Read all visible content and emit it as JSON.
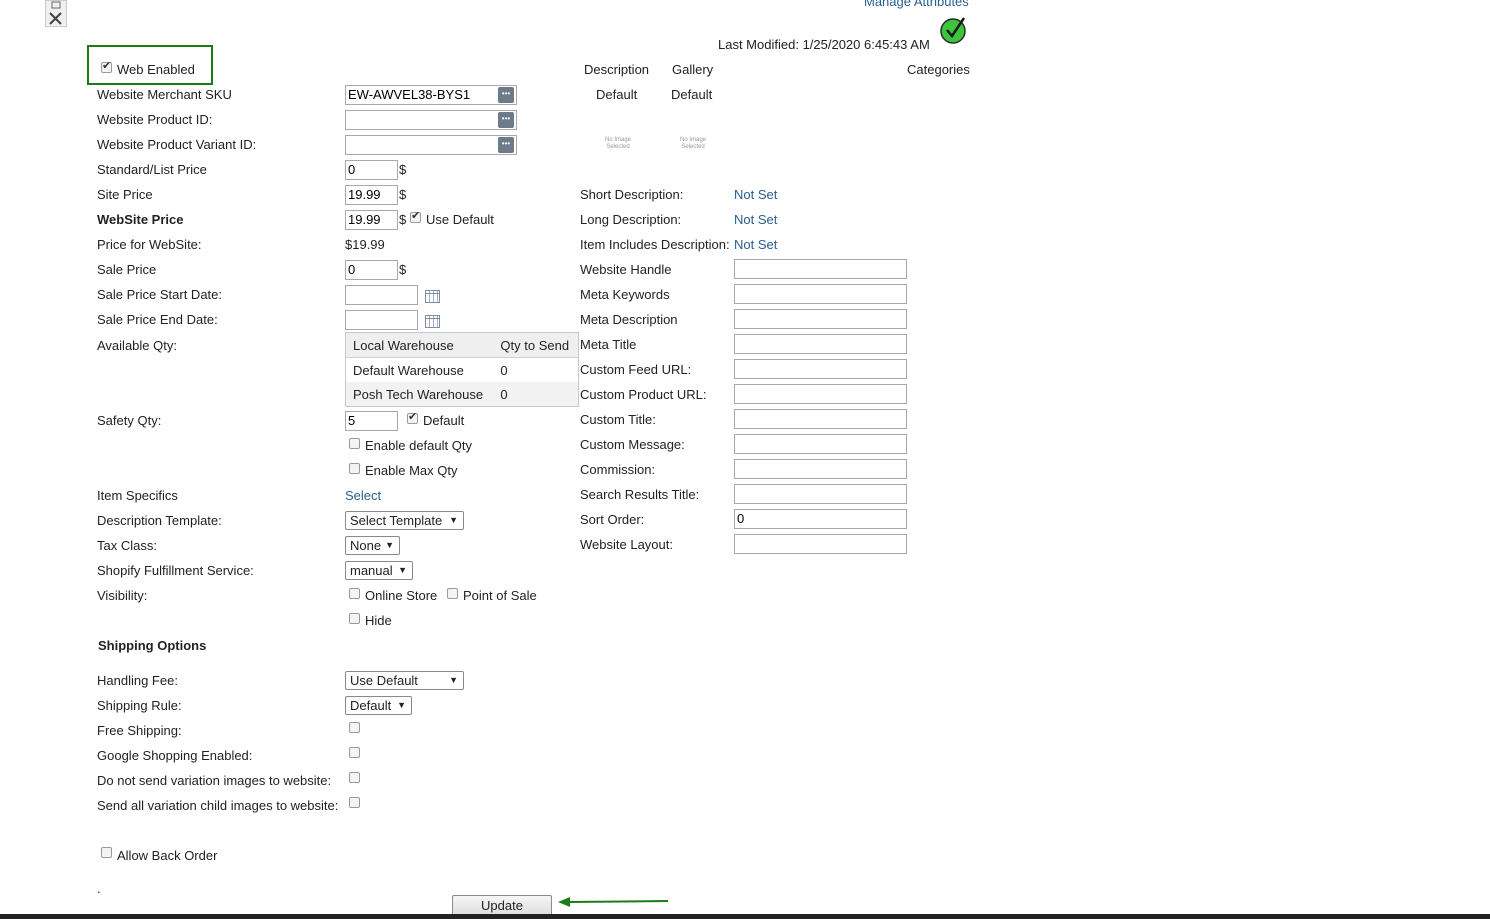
{
  "header": {
    "manage_attributes": "Manage Attributes",
    "last_modified_label": "Last Modified:",
    "last_modified_value": "1/25/2020 6:45:43 AM"
  },
  "web_enabled": {
    "label": "Web Enabled",
    "checked": true
  },
  "media_headers": {
    "description": "Description",
    "gallery": "Gallery",
    "categories": "Categories"
  },
  "media_defaults": {
    "description": "Default",
    "gallery": "Default"
  },
  "no_image": {
    "line1": "No Image",
    "line2": "Selected"
  },
  "left": {
    "merchant_sku": {
      "label": "Website Merchant SKU",
      "value": "EW-AWVEL38-BYS1"
    },
    "product_id": {
      "label": "Website Product ID:",
      "value": ""
    },
    "variant_id": {
      "label": "Website Product Variant ID:",
      "value": ""
    },
    "standard_price": {
      "label": "Standard/List Price",
      "value": "0",
      "unit": "$"
    },
    "site_price": {
      "label": "Site Price",
      "value": "19.99",
      "unit": "$"
    },
    "website_price": {
      "label": "WebSite Price",
      "value": "19.99",
      "unit": "$",
      "use_default_label": "Use Default",
      "use_default_checked": true
    },
    "price_for_website": {
      "label": "Price for WebSite:",
      "value": "$19.99"
    },
    "sale_price": {
      "label": "Sale Price",
      "value": "0",
      "unit": "$"
    },
    "sale_start": {
      "label": "Sale Price Start Date:",
      "value": ""
    },
    "sale_end": {
      "label": "Sale Price End Date:",
      "value": ""
    },
    "available_qty": {
      "label": "Available Qty:"
    },
    "warehouse": {
      "col_warehouse": "Local Warehouse",
      "col_qty": "Qty to Send",
      "rows": [
        {
          "name": "Default Warehouse",
          "qty": "0"
        },
        {
          "name": "Posh Tech Warehouse",
          "qty": "0"
        }
      ]
    },
    "safety_qty": {
      "label": "Safety Qty:",
      "value": "5",
      "default_label": "Default",
      "default_checked": true
    },
    "enable_default_qty": "Enable default Qty",
    "enable_max_qty": "Enable Max Qty",
    "item_specifics": {
      "label": "Item Specifics",
      "link": "Select"
    },
    "description_template": {
      "label": "Description Template:",
      "value": "Select Template"
    },
    "tax_class": {
      "label": "Tax Class:",
      "value": "None"
    },
    "fulfillment": {
      "label": "Shopify Fulfillment Service:",
      "value": "manual"
    },
    "visibility": {
      "label": "Visibility:",
      "online_store": "Online Store",
      "point_of_sale": "Point of Sale",
      "hide": "Hide"
    }
  },
  "shipping": {
    "heading": "Shipping Options",
    "handling_fee": {
      "label": "Handling Fee:",
      "value": "Use Default"
    },
    "shipping_rule": {
      "label": "Shipping Rule:",
      "value": "Default"
    },
    "free_shipping": "Free Shipping:",
    "google_shopping": "Google Shopping Enabled:",
    "no_variation_images": "Do not send variation images to website:",
    "all_variation_images": "Send all variation child images to website:",
    "allow_back_order": "Allow Back Order"
  },
  "right": {
    "short_description": {
      "label": "Short Description:",
      "value": "Not Set"
    },
    "long_description": {
      "label": "Long Description:",
      "value": "Not Set"
    },
    "item_includes": {
      "label": "Item Includes Description:",
      "value": "Not Set"
    },
    "fields": [
      {
        "label": "Website Handle",
        "value": ""
      },
      {
        "label": "Meta Keywords",
        "value": ""
      },
      {
        "label": "Meta Description",
        "value": ""
      },
      {
        "label": "Meta Title",
        "value": ""
      },
      {
        "label": "Custom Feed URL:",
        "value": ""
      },
      {
        "label": "Custom Product URL:",
        "value": ""
      },
      {
        "label": "Custom Title:",
        "value": ""
      },
      {
        "label": "Custom Message:",
        "value": ""
      },
      {
        "label": "Commission:",
        "value": ""
      },
      {
        "label": "Search Results Title:",
        "value": ""
      },
      {
        "label": "Sort Order:",
        "value": "0"
      },
      {
        "label": "Website Layout:",
        "value": ""
      }
    ]
  },
  "footer": {
    "dot": ".",
    "update_button": "Update"
  },
  "colors": {
    "link": "#2a5d8f",
    "highlight": "#1a7d1a",
    "check_icon": "#3cc43c"
  }
}
